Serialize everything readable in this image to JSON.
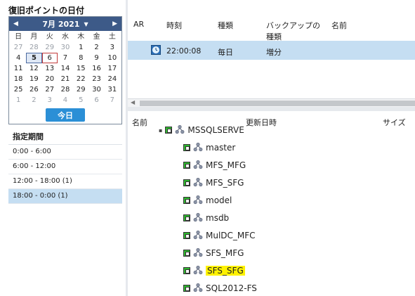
{
  "restore": {
    "title": "復旧ポイントの日付"
  },
  "calendar": {
    "prev_icon": "◀",
    "next_icon": "▶",
    "month_label": "7月 2021",
    "dropdown_icon": "▼",
    "weekdays": [
      "日",
      "月",
      "火",
      "水",
      "木",
      "金",
      "土"
    ],
    "weeks": [
      [
        "27",
        "28",
        "29",
        "30",
        "1",
        "2",
        "3"
      ],
      [
        "4",
        "5",
        "6",
        "7",
        "8",
        "9",
        "10"
      ],
      [
        "11",
        "12",
        "13",
        "14",
        "15",
        "16",
        "17"
      ],
      [
        "18",
        "19",
        "20",
        "21",
        "22",
        "23",
        "24"
      ],
      [
        "25",
        "26",
        "27",
        "28",
        "29",
        "30",
        "31"
      ],
      [
        "1",
        "2",
        "3",
        "4",
        "5",
        "6",
        "7"
      ]
    ],
    "selected_day": "5",
    "today_day": "6",
    "today_button": "今日"
  },
  "period": {
    "title": "指定期間",
    "items": [
      "0:00 - 6:00",
      "6:00 - 12:00",
      "12:00 - 18:00 (1)",
      "18:00 - 0:00 (1)"
    ],
    "selected_index": 3
  },
  "backups": {
    "headers": {
      "ar": "AR",
      "time": "時刻",
      "type": "種類",
      "backup_type_line1": "バックアップの",
      "backup_type_line2": "種類",
      "name": "名前"
    },
    "row": {
      "time": "22:00:08",
      "type": "毎日",
      "backup_type": "増分",
      "icon": "clock-globe-icon"
    }
  },
  "files": {
    "headers": {
      "name": "名前",
      "updated": "更新日時",
      "size": "サイズ"
    },
    "root_label": "MSSQLSERVE",
    "items": [
      "master",
      "MFS_MFG",
      "MFS_SFG",
      "model",
      "msdb",
      "MulDC_MFC",
      "SFS_MFG",
      "SFS_SFG",
      "SQL2012-FS"
    ],
    "highlighted_index": 7
  },
  "colors": {
    "header_blue": "#3d5a88",
    "selection_blue": "#c5def2",
    "button_blue": "#2b8fd6",
    "check_green": "#2fb82f",
    "highlight_yellow": "#fff200"
  }
}
